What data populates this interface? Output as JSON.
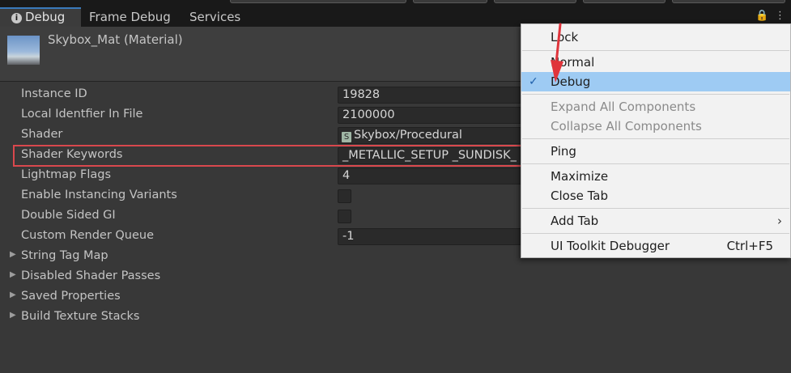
{
  "tabs": {
    "debug": "Debug",
    "frame_debug": "Frame Debug",
    "services": "Services"
  },
  "header": {
    "title": "Skybox_Mat (Material)",
    "lock_glyph": "🔒",
    "more_glyph": "⋮"
  },
  "properties": {
    "instance_id": {
      "label": "Instance ID",
      "value": "19828"
    },
    "local_identifier": {
      "label": "Local Identfier In File",
      "value": "2100000"
    },
    "shader": {
      "label": "Shader",
      "value": "Skybox/Procedural",
      "icon_glyph": "S"
    },
    "shader_keywords": {
      "label": "Shader Keywords",
      "value": "_METALLIC_SETUP _SUNDISK_"
    },
    "lightmap_flags": {
      "label": "Lightmap Flags",
      "value": "4"
    },
    "enable_instancing": {
      "label": "Enable Instancing Variants",
      "checked": false
    },
    "double_sided_gi": {
      "label": "Double Sided GI",
      "checked": false
    },
    "custom_render_queue": {
      "label": "Custom Render Queue",
      "value": "-1"
    }
  },
  "foldouts": {
    "string_tag_map": "String Tag Map",
    "disabled_shader_passes": "Disabled Shader Passes",
    "saved_properties": "Saved Properties",
    "build_texture_stacks": "Build Texture Stacks",
    "arrow_glyph": "▶"
  },
  "menu": {
    "lock": "Lock",
    "normal": "Normal",
    "debug": "Debug",
    "check_glyph": "✓",
    "expand_all": "Expand All Components",
    "collapse_all": "Collapse All Components",
    "ping": "Ping",
    "maximize": "Maximize",
    "close_tab": "Close Tab",
    "add_tab": "Add Tab",
    "submenu_glyph": "›",
    "ui_toolkit_debugger": "UI Toolkit Debugger",
    "ui_toolkit_shortcut": "Ctrl+F5"
  },
  "colors": {
    "accent_tab": "#3a79bb",
    "highlight_box": "#d9484d",
    "menu_selected": "#9ecbf3",
    "annotation_arrow": "#e0343b"
  }
}
